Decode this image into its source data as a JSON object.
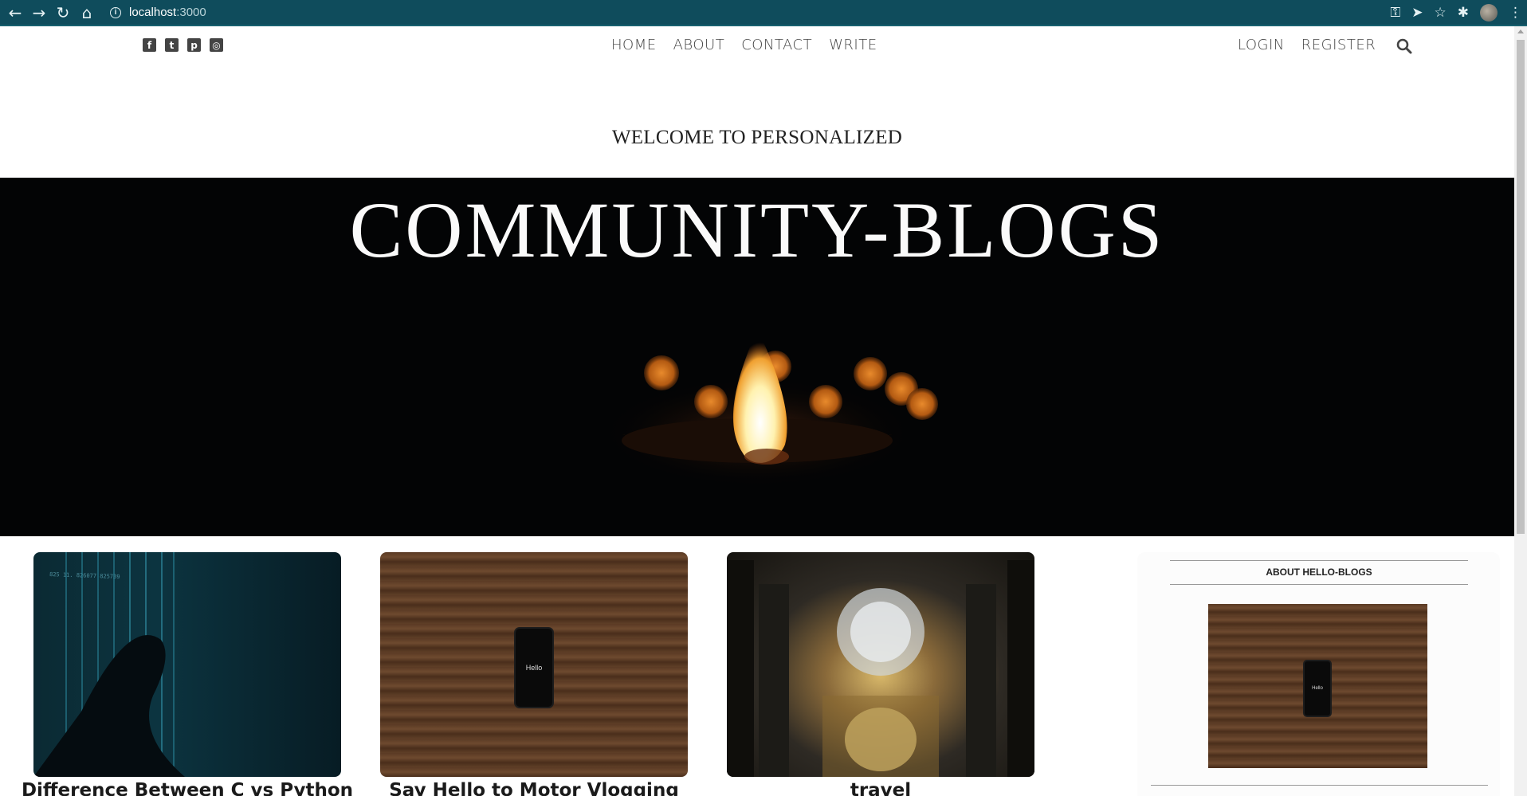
{
  "browser": {
    "url_host": "localhost",
    "url_port": ":3000"
  },
  "nav": {
    "social": [
      {
        "name": "facebook-icon",
        "glyph": "f"
      },
      {
        "name": "twitter-icon",
        "glyph": "t"
      },
      {
        "name": "pinterest-icon",
        "glyph": "p"
      },
      {
        "name": "instagram-icon",
        "glyph": "◎"
      }
    ],
    "menu": [
      "HOME",
      "ABOUT",
      "CONTACT",
      "WRITE"
    ],
    "auth": [
      "LOGIN",
      "REGISTER"
    ]
  },
  "header": {
    "welcome": "WELCOME TO PERSONALIZED",
    "title": "COMMUNITY-BLOGS"
  },
  "posts": [
    {
      "title": "Difference Between C vs Python"
    },
    {
      "title": "Say Hello to Motor Vlogging",
      "phone_text": "Hello"
    },
    {
      "title": "travel"
    }
  ],
  "sidebar": {
    "title": "ABOUT HELLO-BLOGS",
    "phone_text": "Hello"
  }
}
